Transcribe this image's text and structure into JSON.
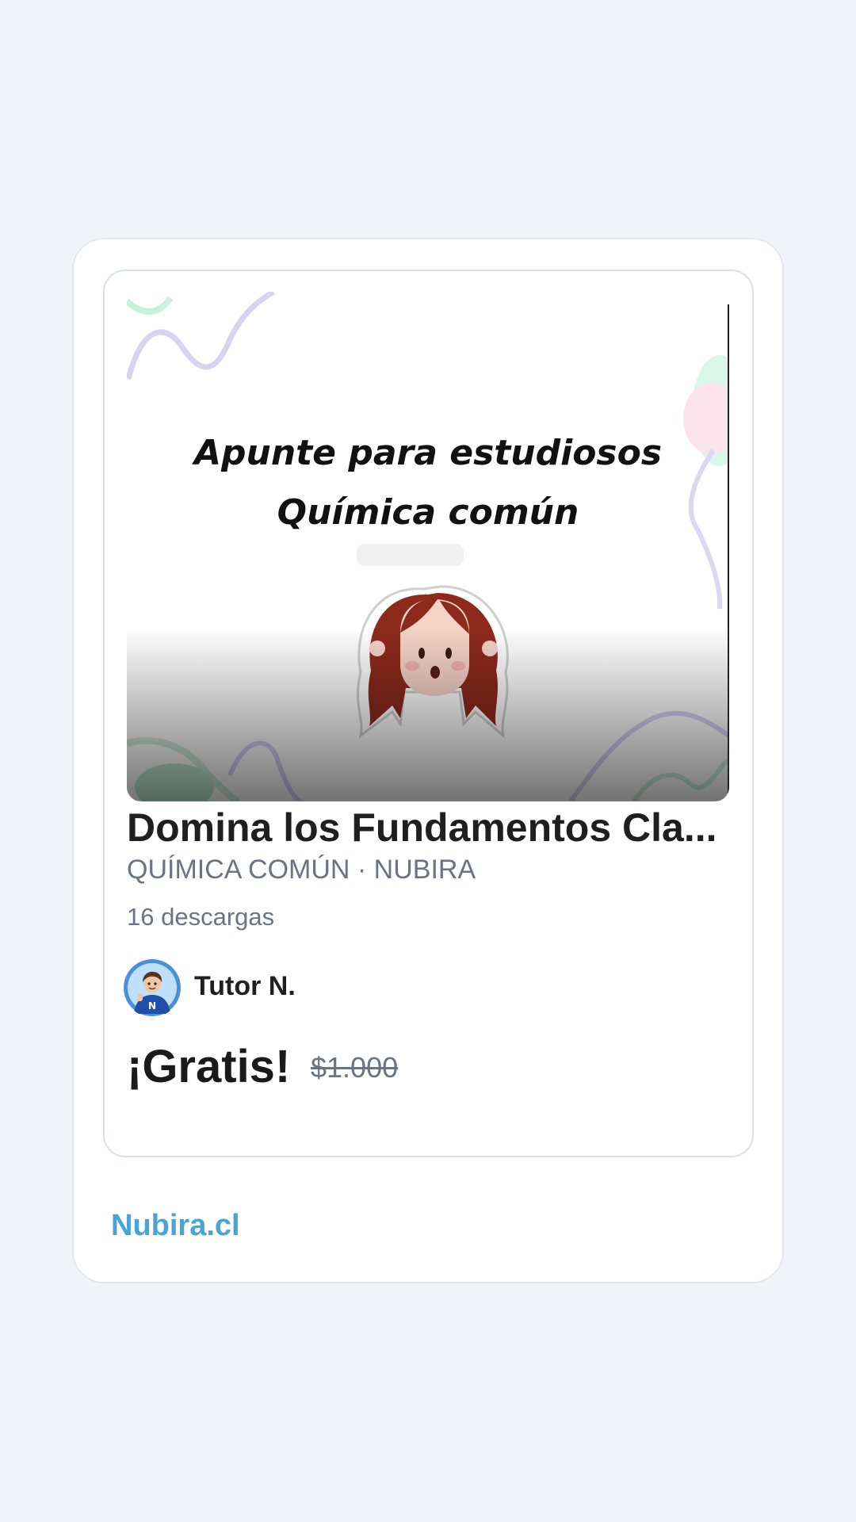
{
  "product": {
    "cover": {
      "line1": "Apunte para estudiosos",
      "line2": "Química común",
      "character": "red-haired-girl-sticker",
      "decorations": [
        "lavender-squiggle",
        "mint-blob",
        "pink-blob",
        "green-squiggle"
      ]
    },
    "title": "Domina los Fundamentos Cla...",
    "subtitle": "QUÍMICA COMÚN · NUBIRA",
    "downloads": "16 descargas",
    "author": {
      "name": "Tutor N.",
      "avatar_icon": "tutor-avatar-icon"
    },
    "price": {
      "current": "¡Gratis!",
      "original": "$1.000"
    }
  },
  "footer": {
    "site_link": "Nubira.cl"
  },
  "colors": {
    "page_background": "#f0f4f8",
    "card_background": "#ffffff",
    "link_accent": "#4aa3d6",
    "muted_text": "#6b7482",
    "primary_text": "#1f1f1f"
  }
}
